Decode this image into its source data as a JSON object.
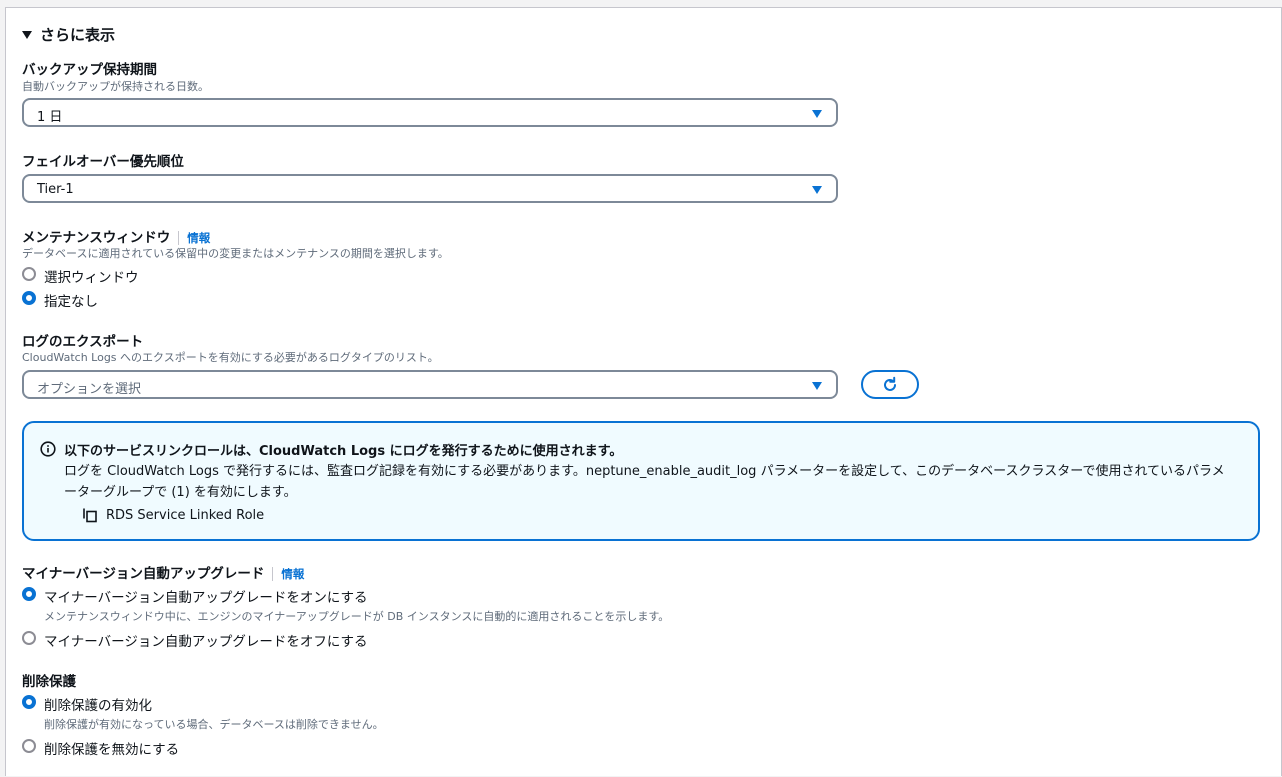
{
  "expander": {
    "label": "さらに表示"
  },
  "backup": {
    "label": "バックアップ保持期間",
    "description": "自動バックアップが保持される日数。",
    "value": "1 日"
  },
  "failover": {
    "label": "フェイルオーバー優先順位",
    "value": "Tier-1"
  },
  "maintenance": {
    "label": "メンテナンスウィンドウ",
    "info": "情報",
    "description": "データベースに適用されている保留中の変更またはメンテナンスの期間を選択します。",
    "options": [
      {
        "label": "選択ウィンドウ",
        "selected": false
      },
      {
        "label": "指定なし",
        "selected": true
      }
    ]
  },
  "log_export": {
    "label": "ログのエクスポート",
    "description": "CloudWatch Logs へのエクスポートを有効にする必要があるログタイプのリスト。",
    "placeholder": "オプションを選択",
    "refresh_icon": "refresh-icon"
  },
  "alert": {
    "icon": "info-icon",
    "title": "以下のサービスリンクロールは、CloudWatch Logs にログを発行するために使用されます。",
    "body": "ログを CloudWatch Logs で発行するには、監査ログ記録を有効にする必要があります。neptune_enable_audit_log パラメーターを設定して、このデータベースクラスターで使用されているパラメーターグループで (1) を有効にします。",
    "link_icon": "copy-icon",
    "link_label": "RDS Service Linked Role"
  },
  "minor_upgrade": {
    "label": "マイナーバージョン自動アップグレード",
    "info": "情報",
    "options": [
      {
        "label": "マイナーバージョン自動アップグレードをオンにする",
        "description": "メンテナンスウィンドウ中に、エンジンのマイナーアップグレードが DB インスタンスに自動的に適用されることを示します。",
        "selected": true
      },
      {
        "label": "マイナーバージョン自動アップグレードをオフにする",
        "selected": false
      }
    ]
  },
  "deletion": {
    "label": "削除保護",
    "options": [
      {
        "label": "削除保護の有効化",
        "description": "削除保護が有効になっている場合、データベースは削除できません。",
        "selected": true
      },
      {
        "label": "削除保護を無効にする",
        "selected": false
      }
    ]
  },
  "colors": {
    "accent": "#0972d3",
    "alert_bg": "#f0fbff",
    "text": "#0f141a",
    "muted": "#5f6b7a"
  }
}
